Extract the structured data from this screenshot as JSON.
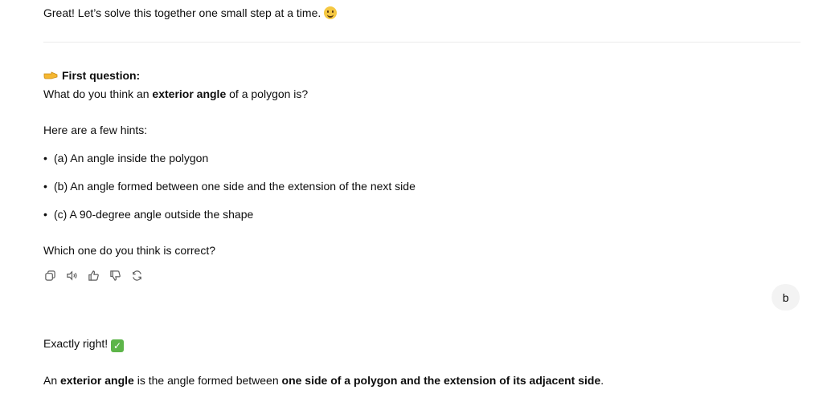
{
  "assistant_1": {
    "intro": "Great! Let’s solve this together one small step at a time.",
    "intro_emoji_icon": "smiling-face-icon",
    "question_heading": "First question:",
    "question_pointer_icon": "pointing-hand-icon",
    "question_pre": "What do you think an ",
    "question_bold": "exterior angle",
    "question_post": " of a polygon is?",
    "hints_label": "Here are a few hints:",
    "hints": [
      "(a) An angle inside the polygon",
      "(b) An angle formed between one side and the extension of the next side",
      "(c) A 90-degree angle outside the shape"
    ],
    "closing_question": "Which one do you think is correct?",
    "actions": [
      "copy-icon",
      "read-aloud-icon",
      "thumbs-up-icon",
      "thumbs-down-icon",
      "regenerate-icon"
    ]
  },
  "user_message": {
    "text": "b"
  },
  "assistant_2": {
    "verdict": "Exactly right!",
    "verdict_icon": "check-mark-icon",
    "def_pre": "An ",
    "def_bold1": "exterior angle",
    "def_mid": " is the angle formed between ",
    "def_bold2": "one side of a polygon and the extension of its adjacent side",
    "def_post": "."
  }
}
